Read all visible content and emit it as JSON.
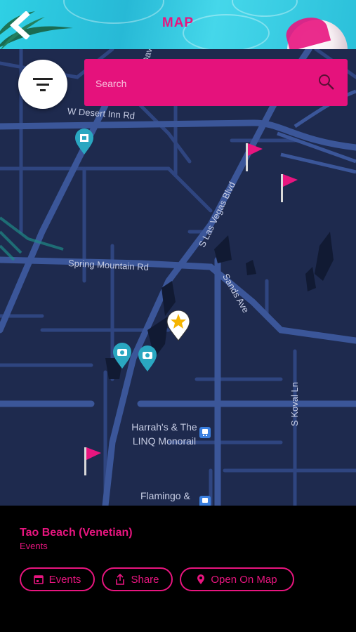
{
  "header": {
    "title": "MAP",
    "back_icon": "chevron-left-icon"
  },
  "search": {
    "placeholder": "Search",
    "value": ""
  },
  "map": {
    "streets": {
      "w_desert_inn": "W Desert Inn Rd",
      "spring_mountain": "Spring Mountain Rd",
      "las_vegas_blvd": "S Las Vegas Blvd",
      "sands_ave": "Sands Ave",
      "koval": "S Koval Ln",
      "dav": "Dav"
    },
    "pois": {
      "harrahs": "Harrah's & The\nLINQ Monorail",
      "flamingo": "Flamingo &"
    }
  },
  "place": {
    "name": "Tao Beach (Venetian)",
    "category": "Events"
  },
  "actions": {
    "events": "Events",
    "share": "Share",
    "open_on_map": "Open On Map"
  },
  "colors": {
    "accent": "#e8157f",
    "map_bg": "#1e2a4e",
    "road": "#3b5699",
    "marker_teal": "#2aa7c1"
  }
}
